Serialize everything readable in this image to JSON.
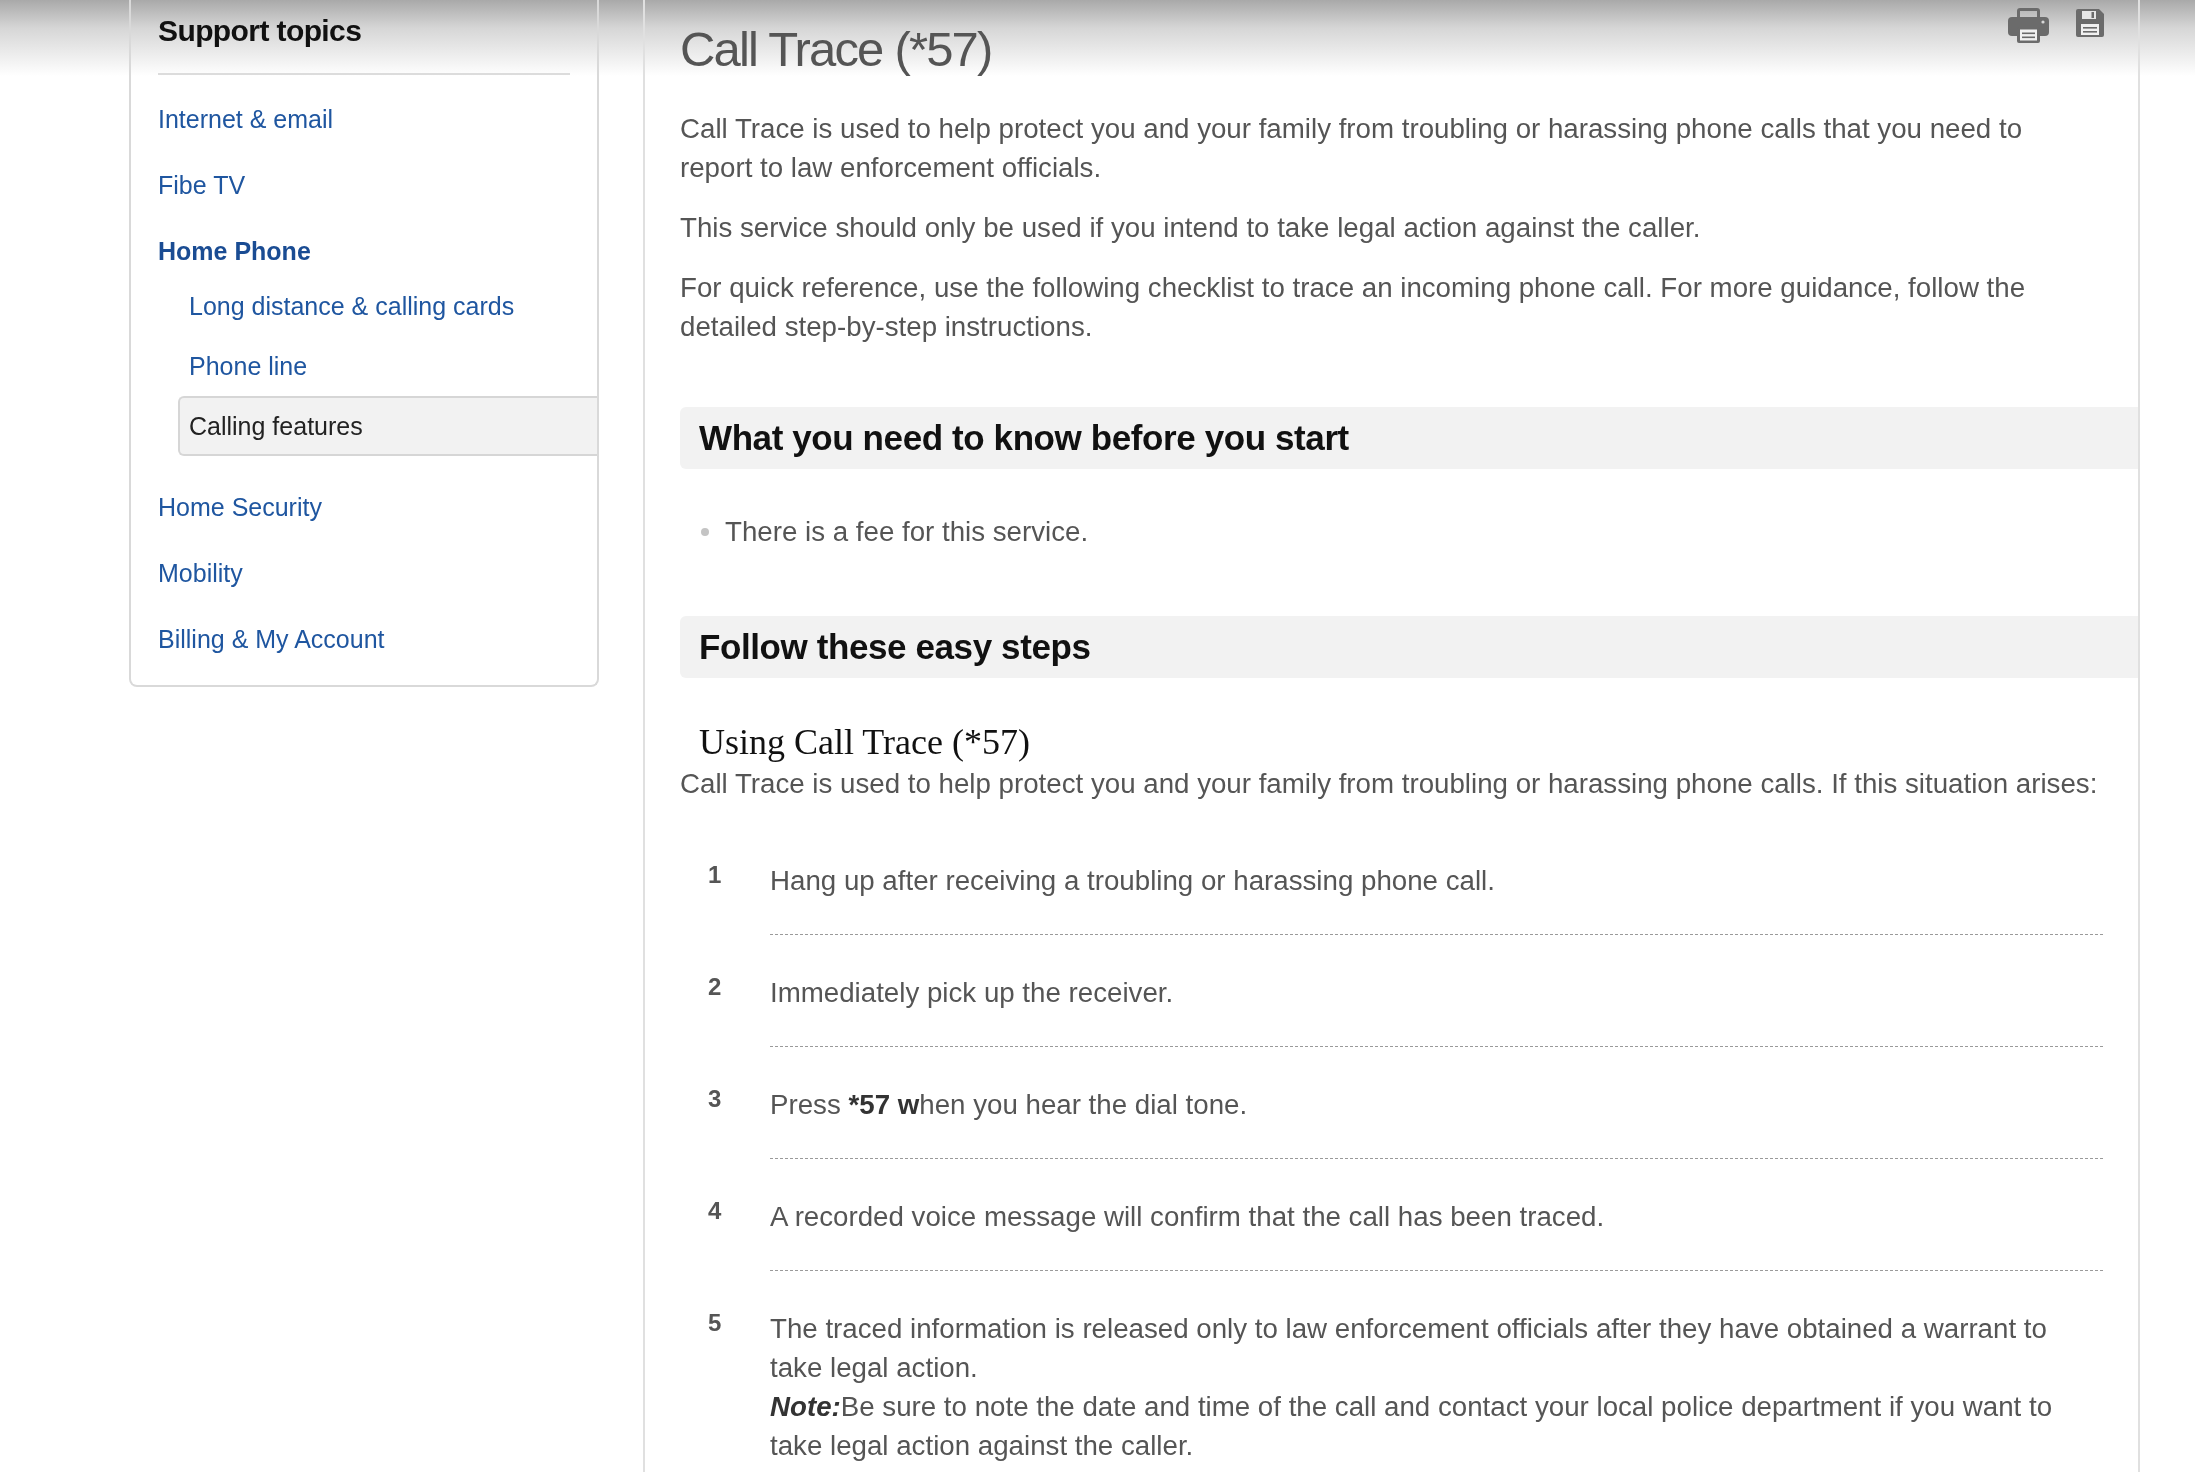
{
  "sidebar": {
    "title": "Support topics",
    "items": [
      {
        "label": "Internet & email",
        "selected": false,
        "expanded": false
      },
      {
        "label": "Fibe TV",
        "selected": false,
        "expanded": false
      },
      {
        "label": "Home Phone",
        "selected": false,
        "expanded": true,
        "children": [
          {
            "label": "Long distance & calling cards",
            "selected": false
          },
          {
            "label": "Phone line",
            "selected": false
          },
          {
            "label": "Calling features",
            "selected": true
          }
        ]
      },
      {
        "label": "Home Security",
        "selected": false,
        "expanded": false
      },
      {
        "label": "Mobility",
        "selected": false,
        "expanded": false
      },
      {
        "label": "Billing & My Account",
        "selected": false,
        "expanded": false
      }
    ]
  },
  "article": {
    "title": "Call Trace (*57)",
    "paragraphs": [
      "Call Trace is used to help protect you and your family from troubling or harassing phone calls that you need to report to law enforcement officials.",
      "This service should only be used if you intend to take legal action against the caller.",
      "For quick reference, use the following checklist to trace an incoming phone call. For more guidance, follow the detailed step-by-step instructions."
    ],
    "sections": [
      {
        "heading": "What you need to know before you start",
        "bullets": [
          "There is a fee for this service."
        ]
      },
      {
        "heading": "Follow these easy steps",
        "subheading": "Using Call Trace (*57)",
        "intro": "Call Trace is used to help protect you and your family from troubling or harassing phone calls. If this situation arises:",
        "steps": [
          {
            "number": "1",
            "runs": [
              {
                "text": "Hang up after receiving a troubling or harassing phone call.",
                "bold": false
              }
            ]
          },
          {
            "number": "2",
            "runs": [
              {
                "text": "Immediately pick up the receiver.",
                "bold": false
              }
            ]
          },
          {
            "number": "3",
            "runs": [
              {
                "text": "Press ",
                "bold": false
              },
              {
                "text": "*57 w",
                "bold": true
              },
              {
                "text": "hen you hear the dial tone.",
                "bold": false
              }
            ]
          },
          {
            "number": "4",
            "runs": [
              {
                "text": "A recorded voice message will confirm that the call has been traced.",
                "bold": false
              }
            ]
          },
          {
            "number": "5",
            "runs": [
              {
                "text": "The traced information is released only to law enforcement officials after they have obtained a warrant to take legal action.",
                "bold": false
              }
            ],
            "note_runs": [
              {
                "text": "Note:",
                "bold": true,
                "italic": true
              },
              {
                "text": "Be sure to note the date and time of the call and contact your local police department if you want to take legal action against the caller.",
                "bold": false,
                "italic": false
              }
            ]
          }
        ]
      }
    ]
  }
}
